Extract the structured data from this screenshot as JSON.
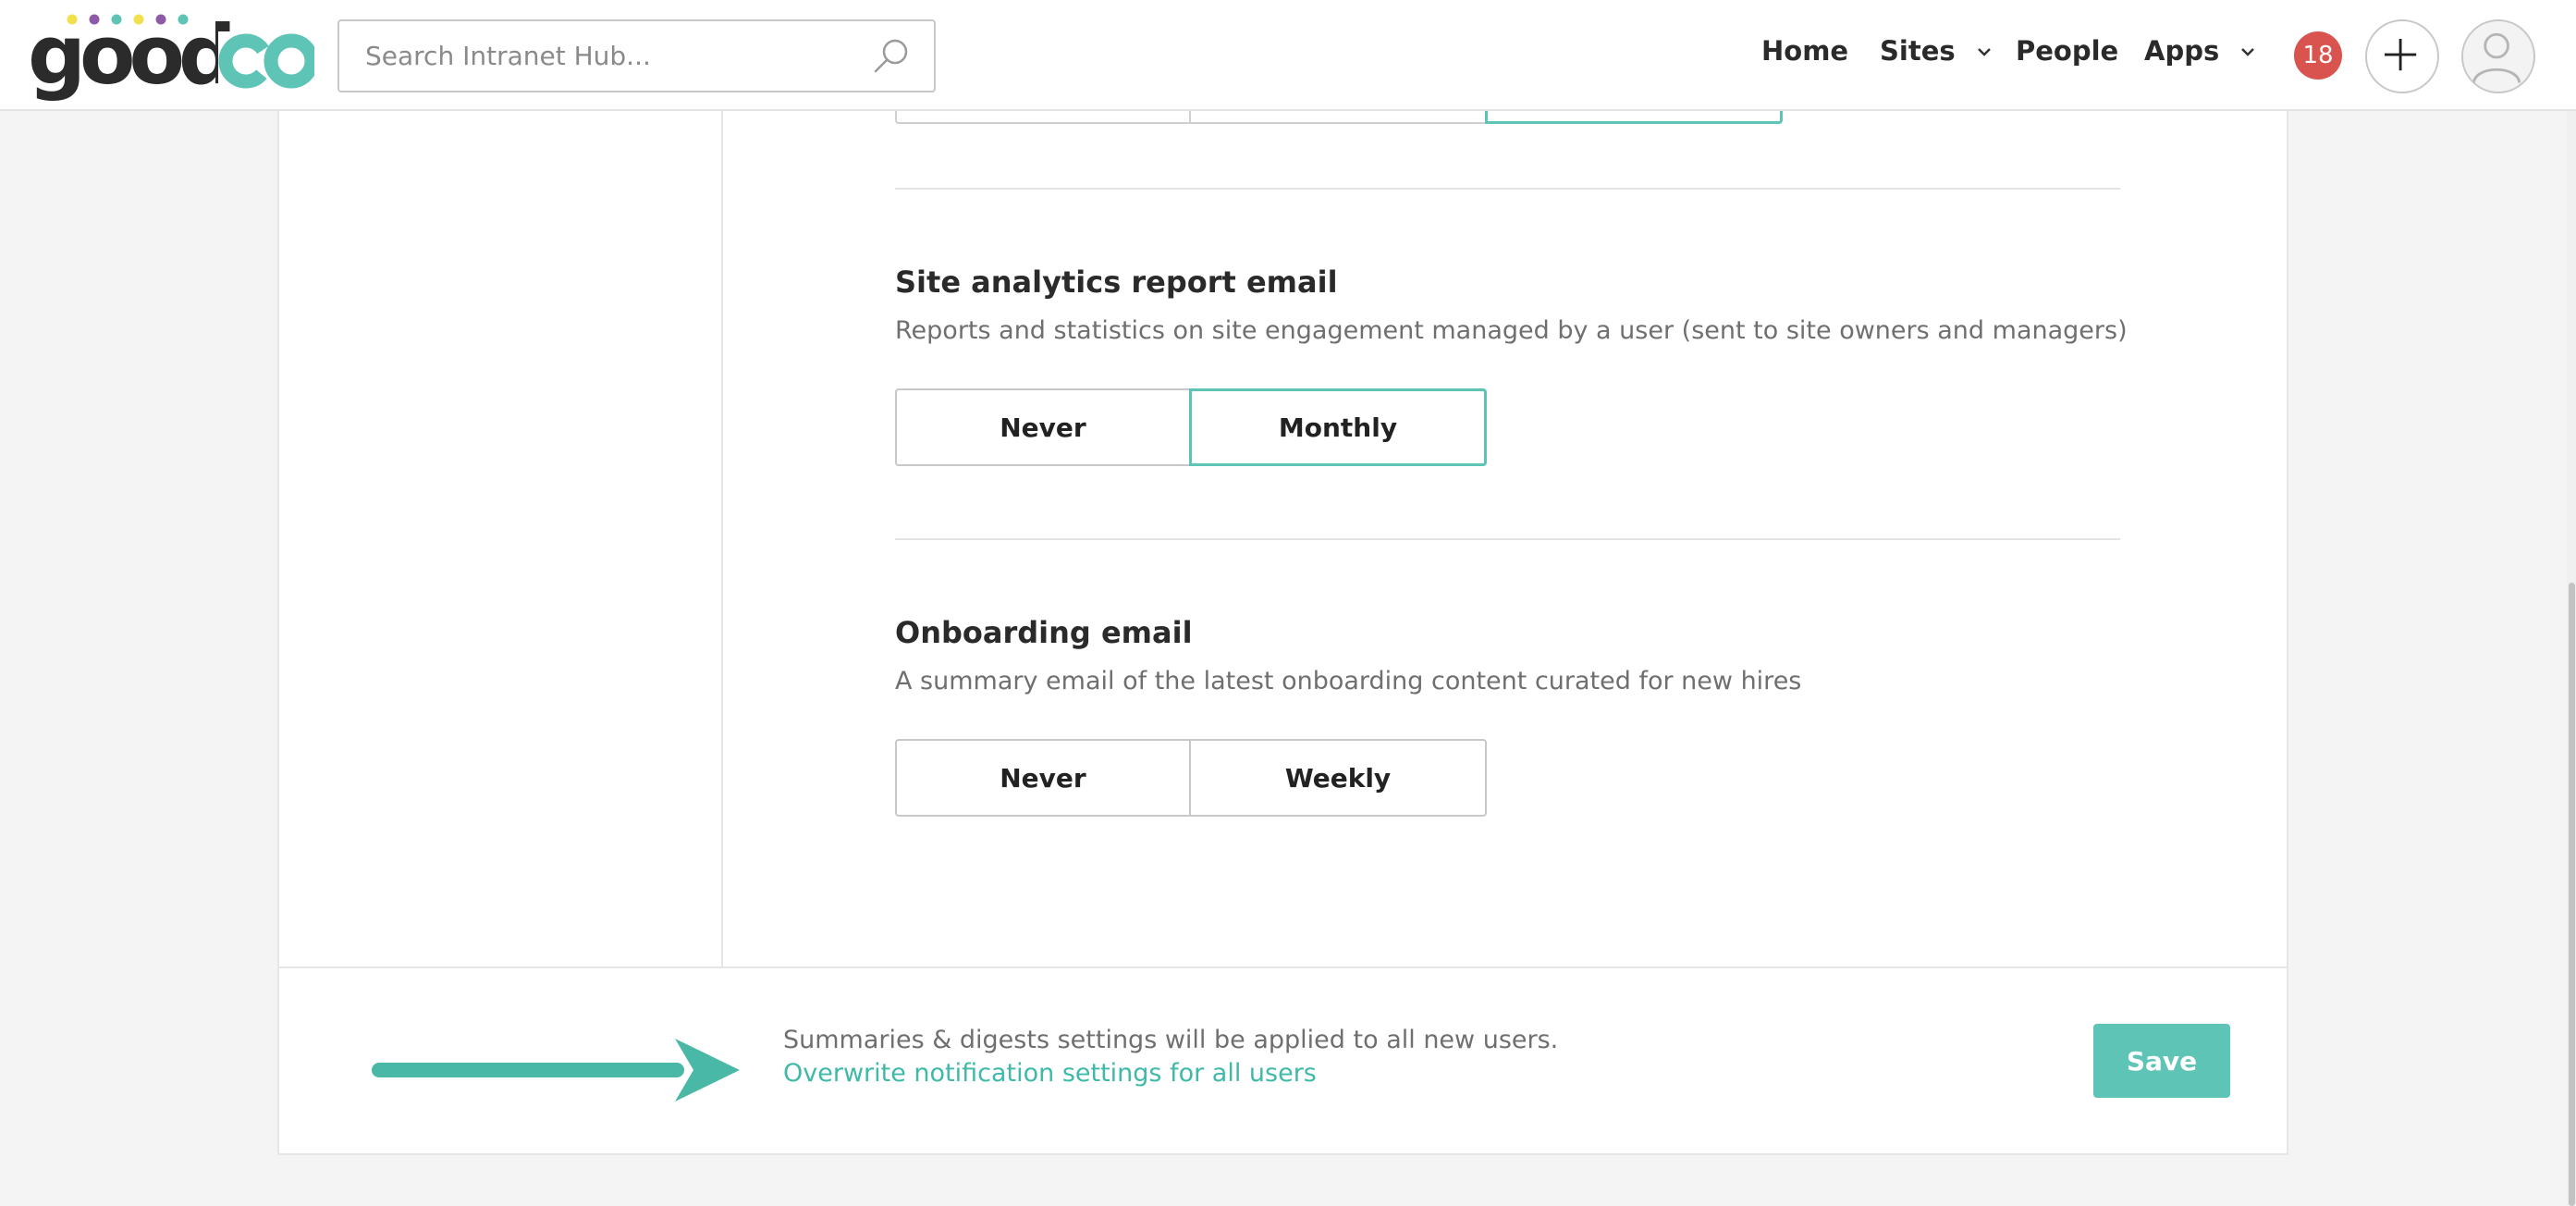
{
  "header": {
    "logo_text": "goodco",
    "search": {
      "placeholder": "Search Intranet Hub..."
    },
    "nav": {
      "home": "Home",
      "sites": "Sites",
      "people": "People",
      "apps": "Apps"
    },
    "notification_count": "18"
  },
  "settings": {
    "sections": [
      {
        "title": "Site analytics report email",
        "description": "Reports and statistics on site engagement managed by a user (sent to site owners and managers)",
        "options": [
          "Never",
          "Monthly"
        ],
        "selected": "Monthly"
      },
      {
        "title": "Onboarding email",
        "description": "A summary email of the latest onboarding content curated for new hires",
        "options": [
          "Never",
          "Weekly"
        ],
        "selected": ""
      }
    ]
  },
  "footer": {
    "note": "Summaries & digests settings will be applied to all new users.",
    "link": "Overwrite notification settings for all users",
    "save_label": "Save"
  },
  "colors": {
    "accent": "#5ec4b6",
    "badge": "#d9534f",
    "logo_dark": "#2b2b2b"
  }
}
